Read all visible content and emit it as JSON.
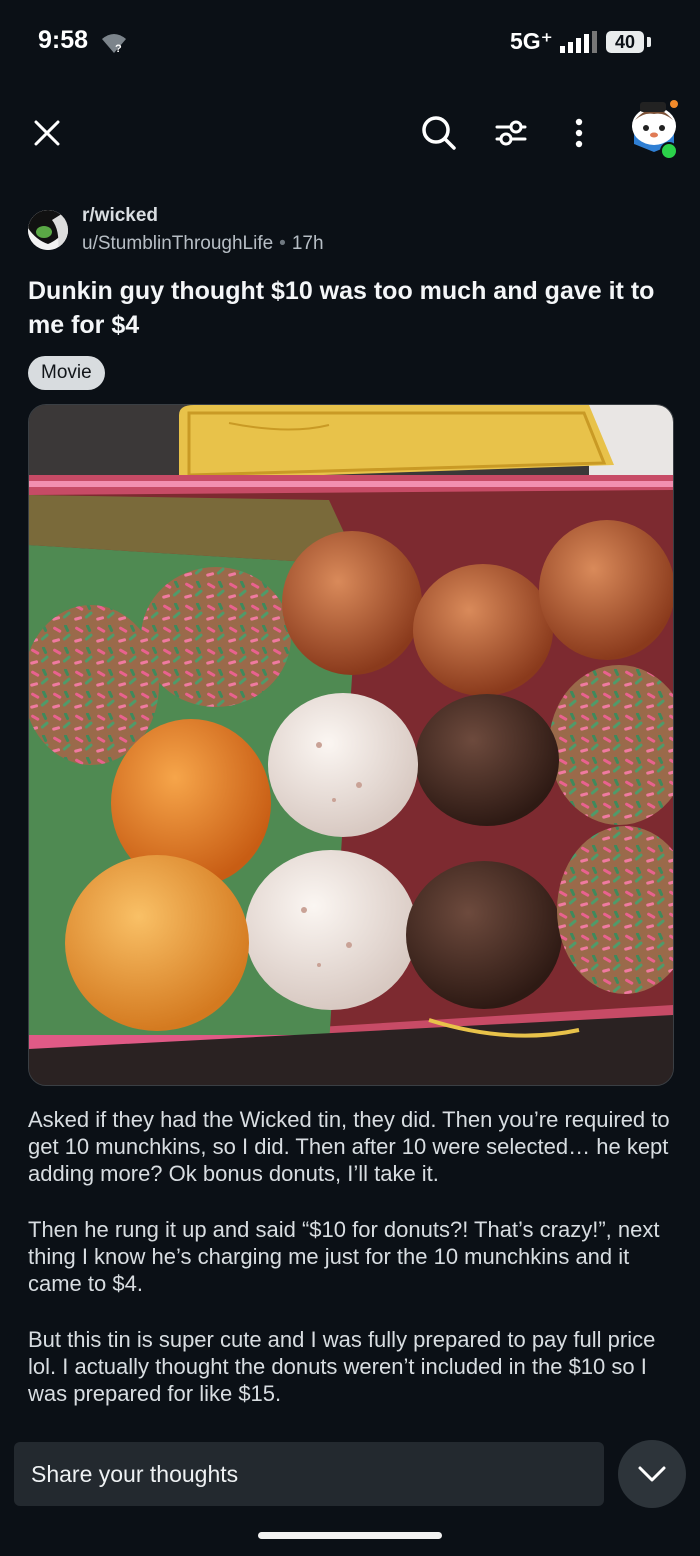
{
  "status_bar": {
    "time": "9:58",
    "network": "5G⁺",
    "battery": "40"
  },
  "nav": {
    "icons": [
      "close-icon",
      "search-icon",
      "filter-icon",
      "more-vertical-icon",
      "user-avatar"
    ]
  },
  "post": {
    "community": "r/wicked",
    "author": "u/StumblinThroughLife",
    "age": "17h",
    "title": "Dunkin guy thought $10 was too much and gave it to me for $4",
    "flair": "Movie",
    "body": [
      "Asked if they had the Wicked tin, they did. Then you’re required to get 10 munchkins, so I did. Then after 10 were selected… he kept adding more? Ok bonus donuts, I’ll take it.",
      "Then he rung it up and said “$10 for donuts?! That’s crazy!”, next thing I know he’s charging me just for the 10 munchkins and it came to $4.",
      "But this tin is super cute and I was fully prepared to pay full price lol. I actually thought the donuts weren’t included in the $10 so I was prepared for like $15."
    ]
  },
  "comment_bar": {
    "placeholder": "Share your thoughts"
  },
  "colors": {
    "background": "#0b1016",
    "flair_bg": "#d8dcdf",
    "online": "#2bd24a",
    "tin_pink": "#e2557a",
    "tin_gold": "#e8c24a"
  }
}
